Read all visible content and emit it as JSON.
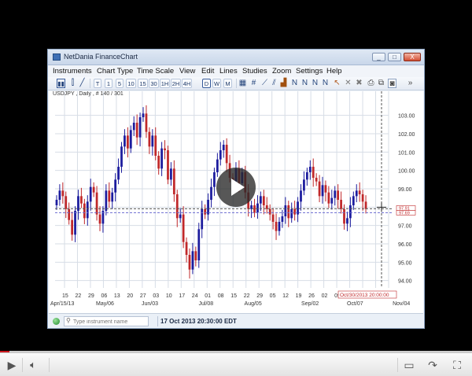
{
  "window": {
    "title": "NetDania FinanceChart",
    "buttons": [
      "_",
      "□",
      "X"
    ]
  },
  "menu": [
    "Instruments",
    "Chart Type",
    "Time Scale",
    "View",
    "Edit",
    "Lines",
    "Studies",
    "Zoom",
    "Settings",
    "Help"
  ],
  "toolbar": {
    "period_buttons": [
      "T",
      "1",
      "5",
      "10",
      "15",
      "30",
      "1H",
      "2H",
      "4H",
      "D",
      "W",
      "M"
    ],
    "selected_period": "D"
  },
  "chart": {
    "symbol_label": "USDJPY , Daily , # 140 / 301",
    "price_ticks": [
      "103.00",
      "102.00",
      "101.00",
      "100.00",
      "99.00",
      "98.00",
      "97.00",
      "96.00",
      "95.00",
      "94.00"
    ],
    "day_ticks": [
      "15",
      "22",
      "29",
      "06",
      "13",
      "20",
      "27",
      "03",
      "10",
      "17",
      "24",
      "01",
      "08",
      "15",
      "22",
      "29",
      "05",
      "12",
      "19",
      "26",
      "02",
      "09",
      "16",
      "23",
      "30",
      "07"
    ],
    "month_labels": [
      "Apr/15/13",
      "May/06",
      "Jun/03",
      "Jul/08",
      "Aug/05",
      "Sep/02",
      "Oct/07",
      "Nov/04"
    ],
    "crosshair_date": "Oct/30/2013 20:00:00",
    "price_tags": [
      "97.91",
      "97.69"
    ],
    "colors": {
      "up": "#1c1c9e",
      "down": "#c0282a",
      "grid": "#d7dde6",
      "crosshair": "#555555",
      "tag": "#c0282a"
    }
  },
  "chart_data": {
    "type": "candlestick",
    "title": "USDJPY , Daily , # 140 / 301",
    "ylim": [
      93.6,
      103.8
    ],
    "closes": [
      98.4,
      98.9,
      98.6,
      97.9,
      97.3,
      96.5,
      97.8,
      98.6,
      98.2,
      97.4,
      98.3,
      99.1,
      98.8,
      97.6,
      97.1,
      97.8,
      98.9,
      98.3,
      98.8,
      99.5,
      100.2,
      101.3,
      101.9,
      101.2,
      102.2,
      102.6,
      101.8,
      102.9,
      103.1,
      102.1,
      101.3,
      101.9,
      100.8,
      100.1,
      101.2,
      101.1,
      99.5,
      100.1,
      98.7,
      97.4,
      97.6,
      96.1,
      95.4,
      94.6,
      95.6,
      95.1,
      96.8,
      97.9,
      97.6,
      98.4,
      99.1,
      99.9,
      100.6,
      101.1,
      101.4,
      100.4,
      99.6,
      99.4,
      100.1,
      99.3,
      99.9,
      98.8,
      97.9,
      98.1,
      97.7,
      98.2,
      98.6,
      98.1,
      97.9,
      97.6,
      97.2,
      96.7,
      97.2,
      97.5,
      98.1,
      97.4,
      97.9,
      97.6,
      98.3,
      98.9,
      99.5,
      99.9,
      100.2,
      99.6,
      99.4,
      98.6,
      99.2,
      98.8,
      98.2,
      98.5,
      98.9,
      98.4,
      97.9,
      97.1,
      97.4,
      98.1,
      98.6,
      98.9,
      98.7,
      98.3,
      97.9
    ],
    "last_price": 97.91
  },
  "status": {
    "search_placeholder": "Type instrument name",
    "timestamp": "17 Oct 2013 20:30:00 EDT"
  },
  "player": {
    "progress": 0.02
  }
}
